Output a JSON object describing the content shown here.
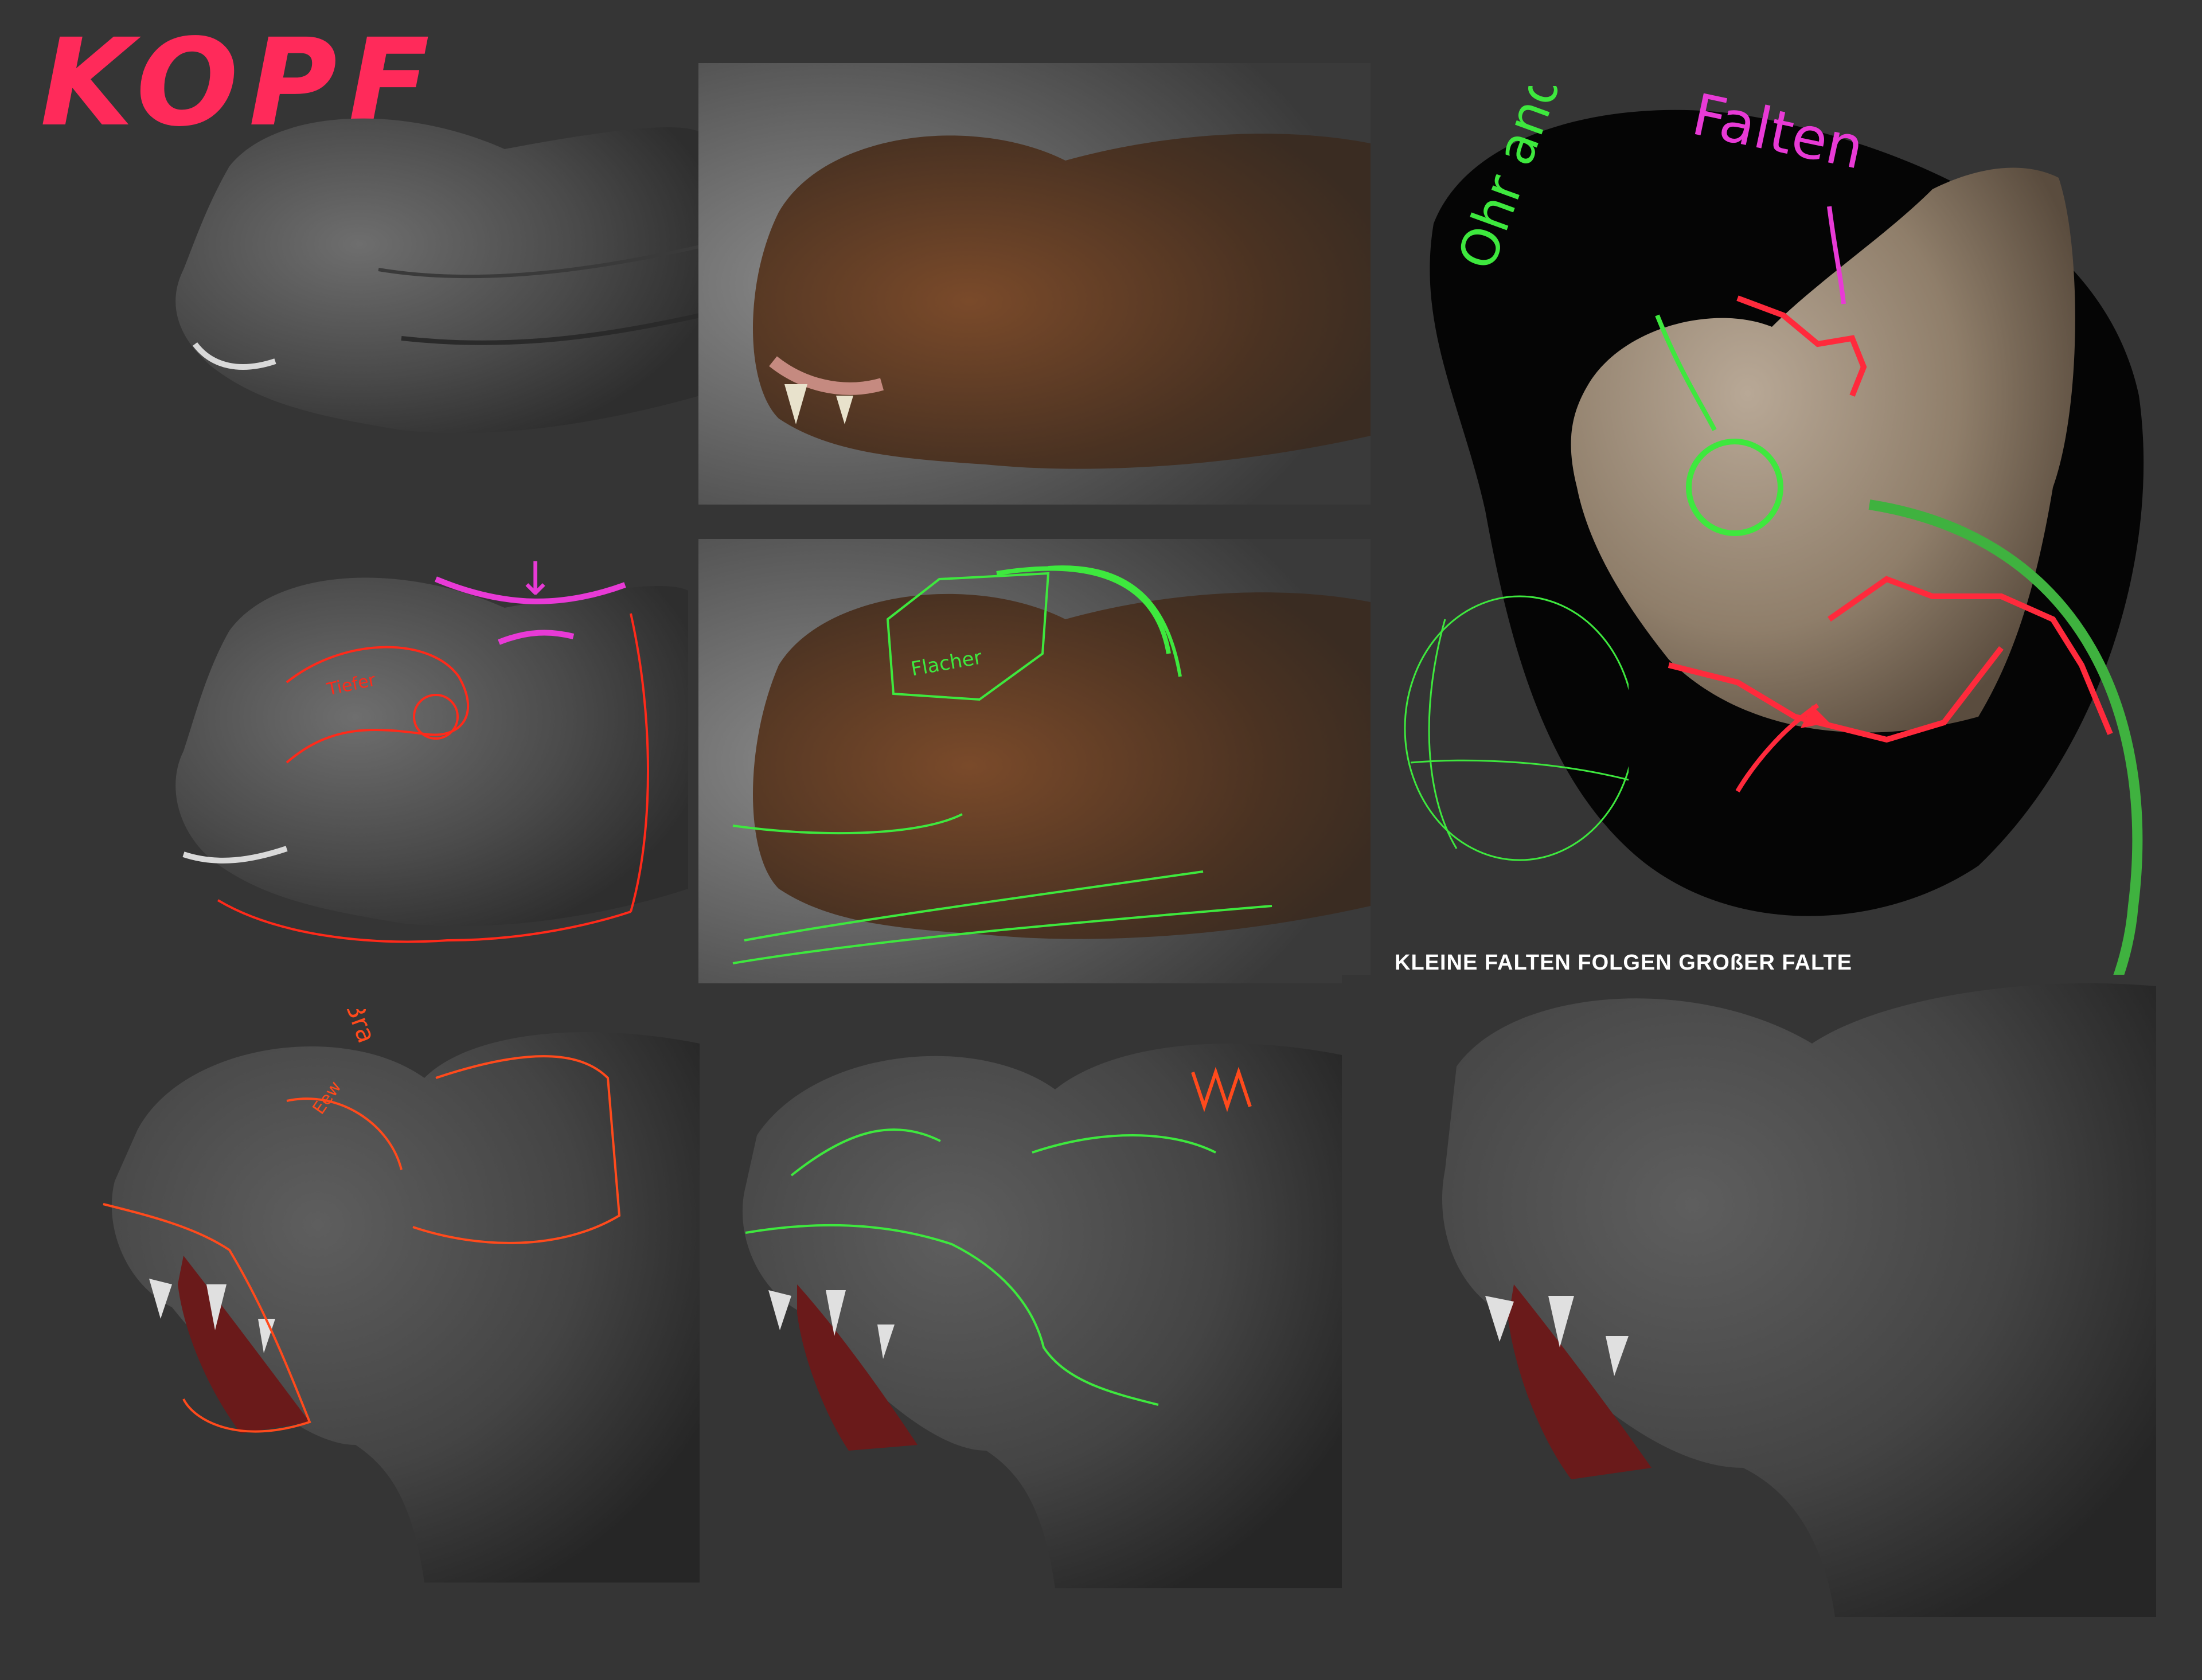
{
  "title": "KOPF",
  "caption": "KLEINE FALTEN FOLGEN GROßER FALTE",
  "notes": {
    "ear": "Ohr andeuten",
    "folds": "Falten",
    "flatter": "Flacher",
    "deep": "Tiefer",
    "brow": "Bra",
    "brow2": "Eew"
  },
  "colors": {
    "background": "#353535",
    "red_marker": "#ff2a3c",
    "orange_marker": "#ff4a1c",
    "green_marker": "#3ee83e",
    "magenta_marker": "#e83ad6",
    "text": "#ffffff"
  },
  "panels": [
    "sculpt-side-view",
    "painted-side-view",
    "sculpt-side-annotated",
    "painted-side-annotated",
    "reference-photo",
    "sculpt-front-annotated-red",
    "sculpt-front-annotated-green",
    "sculpt-front-final"
  ]
}
